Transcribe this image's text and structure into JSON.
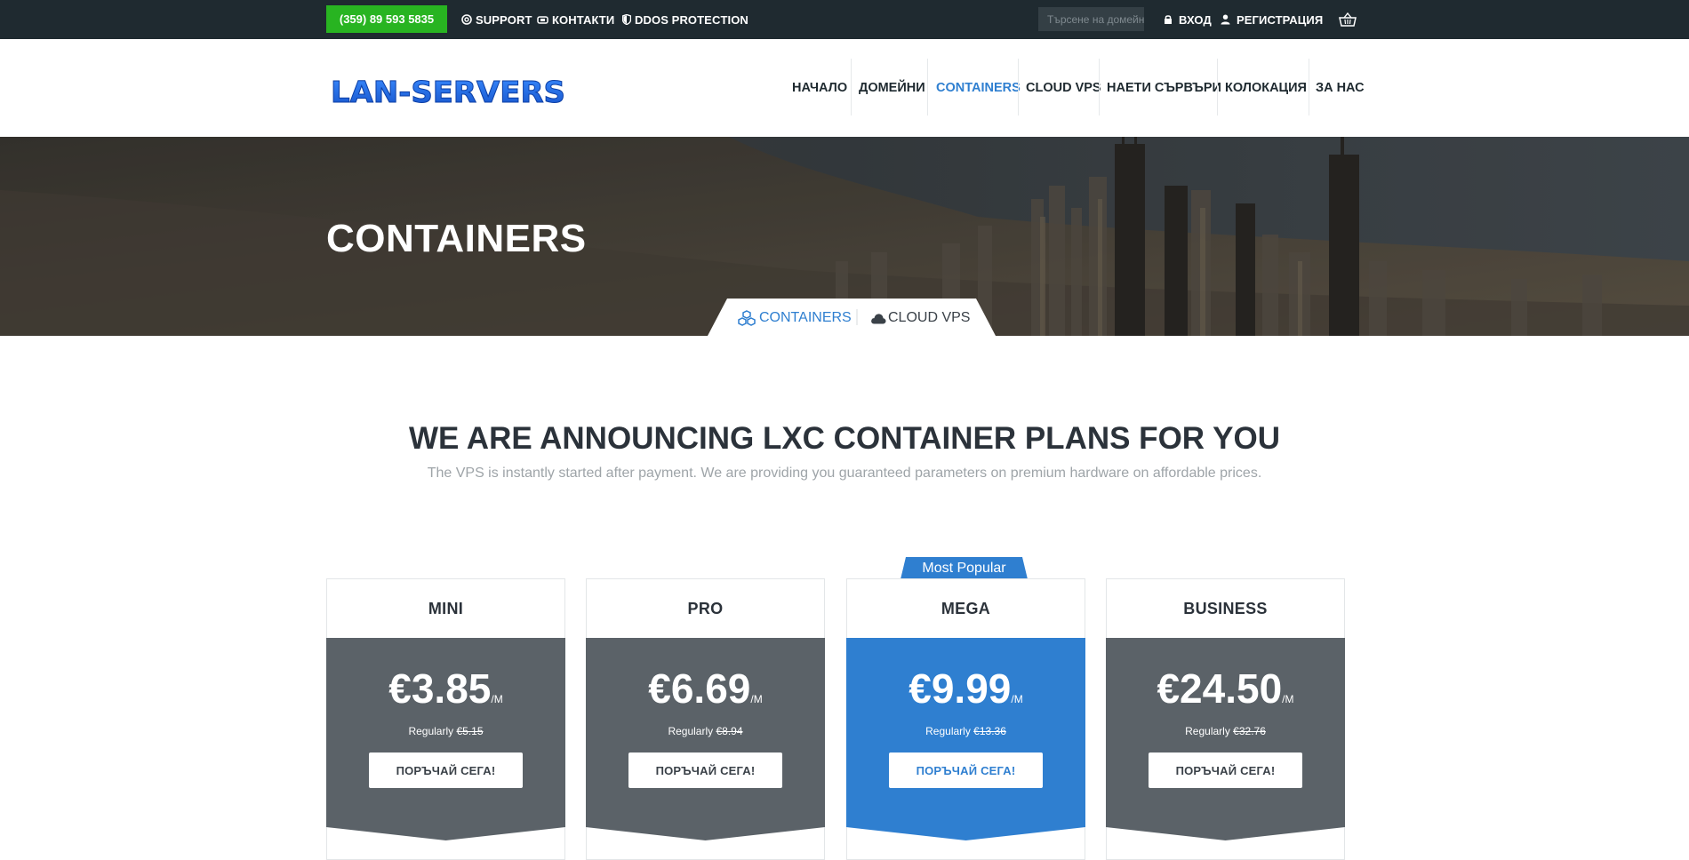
{
  "topbar": {
    "phone": "(359) 89 593 5835",
    "support": "SUPPORT",
    "contacts": "КОНТАКТИ",
    "ddos": "DDOS PROTECTION",
    "search_placeholder": "Търсене на домейн",
    "login": "ВХОД",
    "register": "РЕГИСТРАЦИЯ"
  },
  "header": {
    "logo": "LAN-SERVERS",
    "nav": [
      "НАЧАЛО",
      "ДОМЕЙНИ",
      "CONTAINERS",
      "CLOUD VPS",
      "НАЕТИ СЪРВЪРИ",
      "КОЛОКАЦИЯ",
      "ЗА НАС"
    ],
    "active": "CONTAINERS"
  },
  "hero": {
    "title": "CONTAINERS",
    "tabs": [
      "CONTAINERS",
      "CLOUD VPS"
    ]
  },
  "announcement": {
    "title": "WE ARE ANNOUNCING LXC CONTAINER PLANS FOR YOU",
    "subtitle": "The VPS is instantly started after payment. We are providing you guaranteed parameters on premium hardware on affordable prices."
  },
  "plans": [
    {
      "name": "MINI",
      "price": "€3.85",
      "per": "/M",
      "regular_label": "Regularly",
      "regular_price": "€5.15",
      "button": "ПОРЪЧАЙ СЕГА!",
      "color": "#5b6268"
    },
    {
      "name": "PRO",
      "price": "€6.69",
      "per": "/M",
      "regular_label": "Regularly",
      "regular_price": "€8.94",
      "button": "ПОРЪЧАЙ СЕГА!",
      "color": "#5b6268"
    },
    {
      "name": "MEGA",
      "price": "€9.99",
      "per": "/M",
      "regular_label": "Regularly",
      "regular_price": "€13.36",
      "button": "ПОРЪЧАЙ СЕГА!",
      "color": "#2f7fd0"
    },
    {
      "name": "BUSINESS",
      "price": "€24.50",
      "per": "/M",
      "regular_label": "Regularly",
      "regular_price": "€32.76",
      "button": "ПОРЪЧАЙ СЕГА!",
      "color": "#5b6268"
    }
  ],
  "popular_badge": "Most Popular",
  "colors": {
    "topbar": "#1f2a30",
    "phone_green": "#28b421",
    "accent_blue": "#2f7fd0",
    "plan_grey": "#5b6268"
  }
}
